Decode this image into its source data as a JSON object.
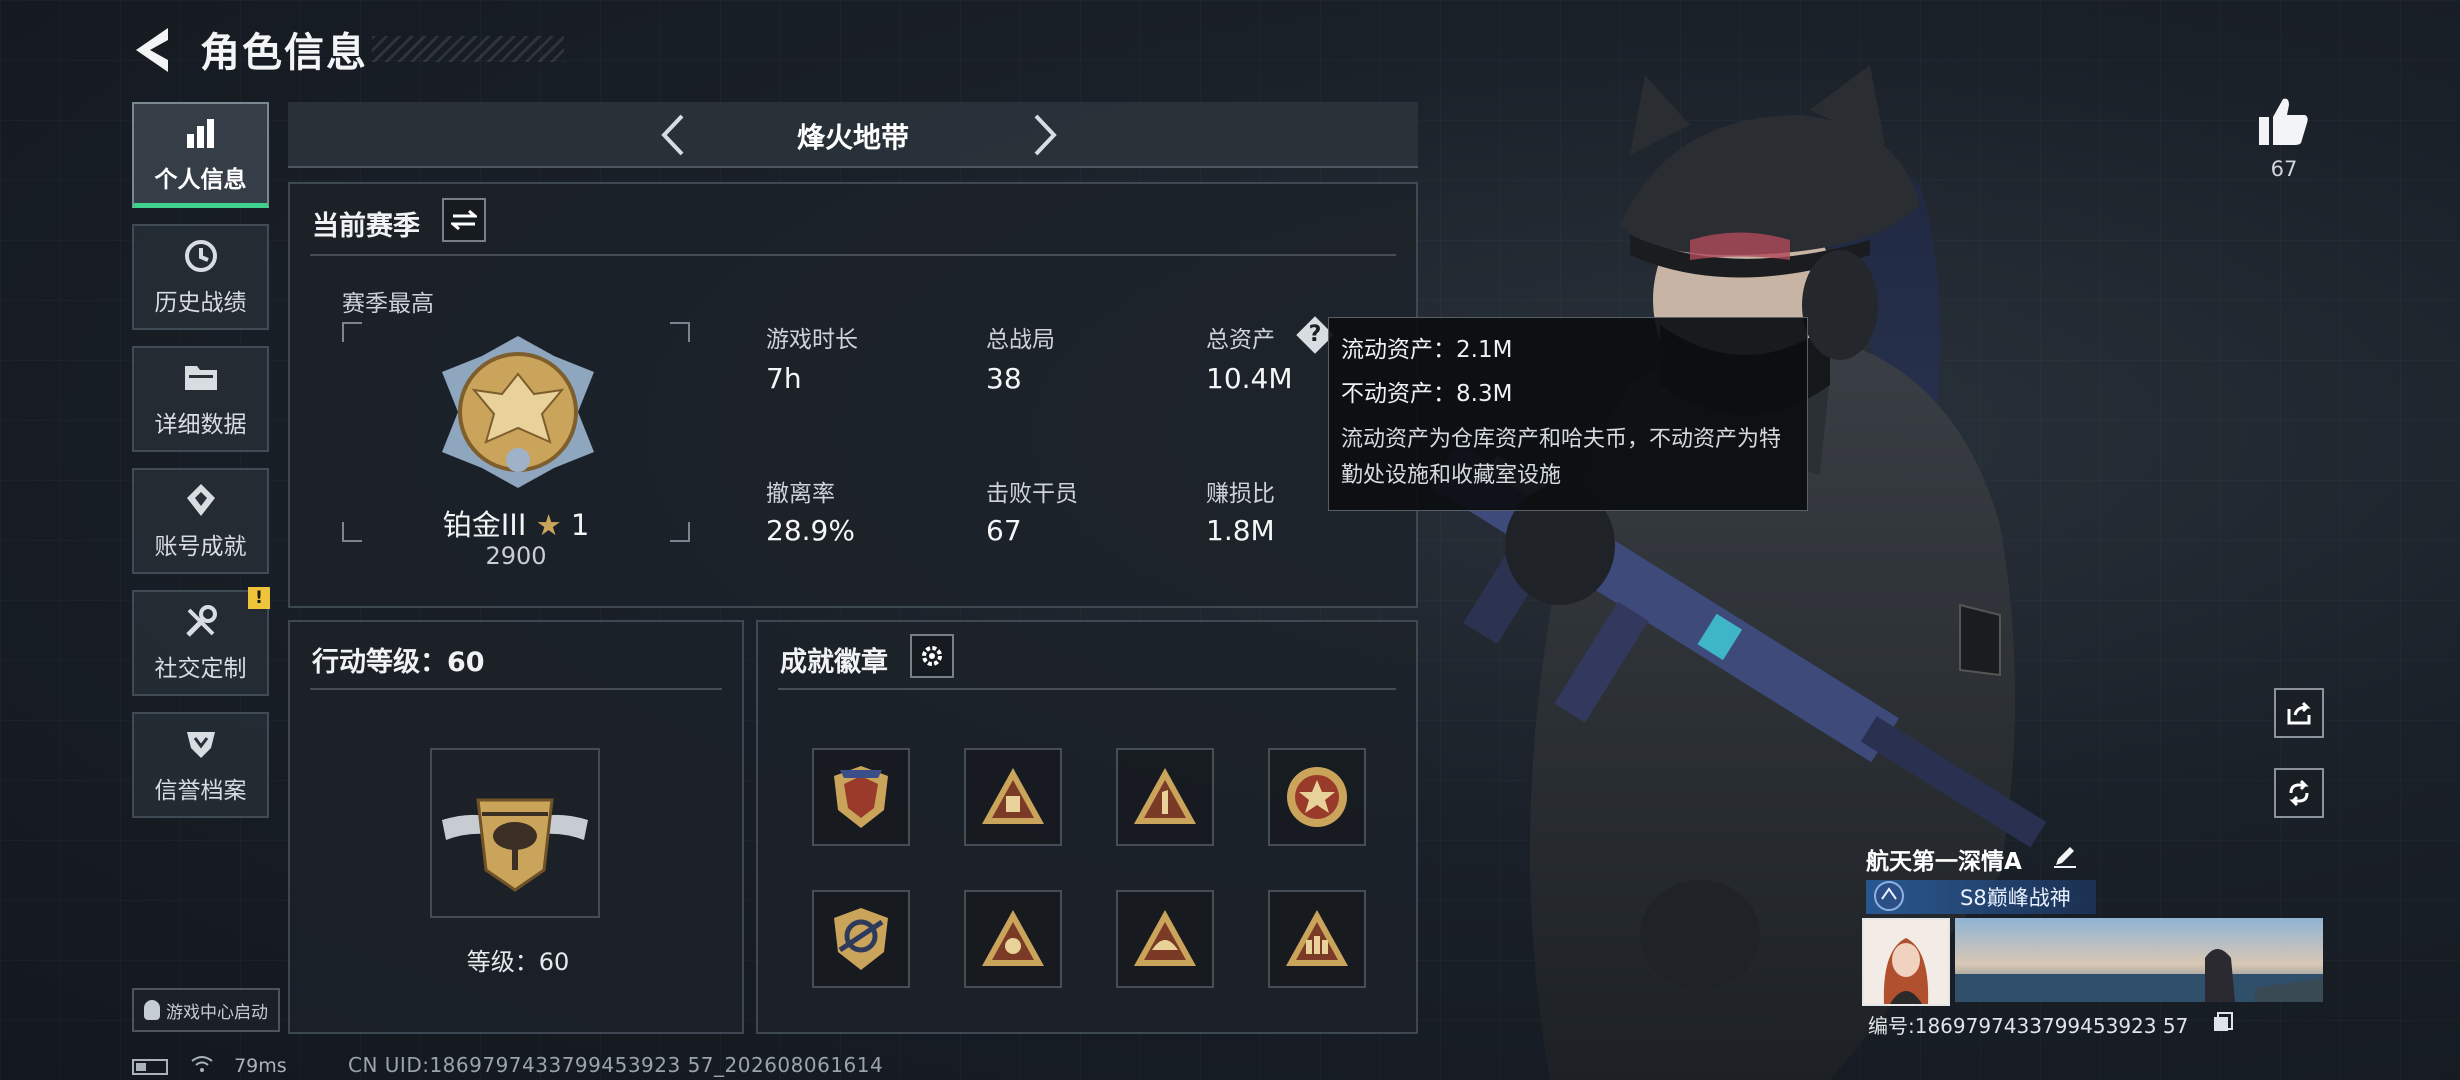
{
  "header": {
    "title": "角色信息"
  },
  "nav": {
    "items": [
      {
        "label": "个人信息",
        "icon": "bar-chart-icon",
        "active": true
      },
      {
        "label": "历史战绩",
        "icon": "history-clock-icon"
      },
      {
        "label": "详细数据",
        "icon": "folder-icon"
      },
      {
        "label": "账号成就",
        "icon": "achievement-diamond-icon"
      },
      {
        "label": "社交定制",
        "icon": "tools-icon",
        "badge": "!"
      },
      {
        "label": "信誉档案",
        "icon": "credit-shield-icon"
      }
    ],
    "game_center_label": "游戏中心启动"
  },
  "mode": {
    "title": "烽火地带"
  },
  "season": {
    "title": "当前赛季",
    "best_label": "赛季最高",
    "rank_name": "铂金III",
    "rank_stars": "1",
    "rank_points": "2900",
    "stats": [
      {
        "label": "游戏时长",
        "value": "7h"
      },
      {
        "label": "总战局",
        "value": "38"
      },
      {
        "label": "总资产",
        "value": "10.4M",
        "has_help": true
      },
      {
        "label": "撤离率",
        "value": "28.9%"
      },
      {
        "label": "击败干员",
        "value": "67"
      },
      {
        "label": "赚损比",
        "value": "1.8M"
      }
    ]
  },
  "tooltip": {
    "liquid": "流动资产：2.1M",
    "fixed": "不动资产：8.3M",
    "description": "流动资产为仓库资产和哈夫币，不动资产为特勤处设施和收藏室设施"
  },
  "action_level": {
    "title": "行动等级：60",
    "level_label": "等级：60"
  },
  "badges": {
    "title": "成就徽章",
    "items": [
      "red-star-shield-badge",
      "gold-triangle-badge",
      "number-one-triangle-badge",
      "red-star-circle-badge",
      "target-shield-badge",
      "gold-triangle-emblem-badge",
      "helmet-triangle-badge",
      "soldiers-triangle-badge"
    ]
  },
  "profile": {
    "likes": "67",
    "player_name": "航天第一深情A",
    "title": "S8巅峰战神",
    "player_id": "编号:1869797433799453923 57"
  },
  "footer": {
    "ping": "79ms",
    "uid": "CN UID:1869797433799453923 57_202608061614"
  },
  "colors": {
    "accent_green": "#3fcf8e",
    "gold": "#c9a45a",
    "warning_yellow": "#f0c43a",
    "title_blue": "#2a5a96"
  }
}
